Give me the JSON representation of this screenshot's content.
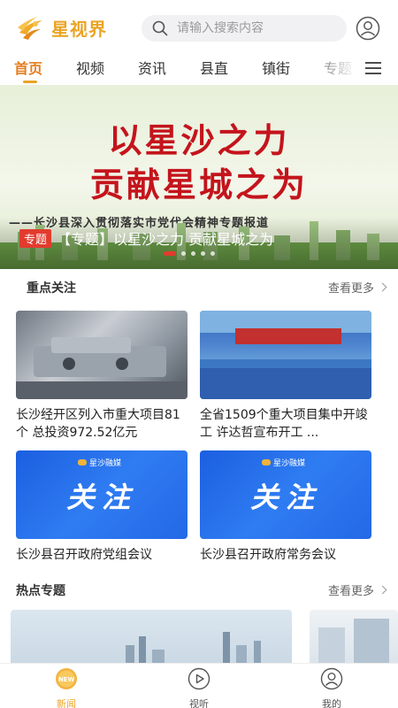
{
  "header": {
    "app_name": "星视界",
    "search_placeholder": "请输入搜索内容"
  },
  "nav": {
    "tabs": [
      "首页",
      "视频",
      "资讯",
      "县直",
      "镇街",
      "专题"
    ],
    "active": "首页"
  },
  "banner": {
    "title_line1": "以星沙之力",
    "title_line2": "贡献星城之为",
    "subtitle": "——长沙县深入贯彻落实市党代会精神专题报道",
    "badge": "专题",
    "caption": "【专题】以星沙之力 贡献星城之为",
    "slide_count": 5,
    "active_slide": 1
  },
  "focus": {
    "title": "重点关注",
    "more": "查看更多",
    "cards": [
      {
        "title": "长沙经开区列入市重大项目81个 总投资972.52亿元"
      },
      {
        "title": "全省1509个重大项目集中开竣工 许达哲宣布开工 ..."
      },
      {
        "title": "长沙县召开政府党组会议",
        "image_heading": "关注",
        "image_brand": "星沙融媒"
      },
      {
        "title": "长沙县召开政府常务会议",
        "image_heading": "关注",
        "image_brand": "星沙融媒"
      }
    ]
  },
  "hot": {
    "title": "热点专题",
    "more": "查看更多"
  },
  "bottom_nav": {
    "items": [
      {
        "label": "新闻",
        "badge": "NEW",
        "icon": "news-icon"
      },
      {
        "label": "视听",
        "icon": "play-icon"
      },
      {
        "label": "我的",
        "icon": "user-icon"
      }
    ],
    "active": "新闻"
  },
  "colors": {
    "brand": "#e9a425",
    "active_tab": "#e47d1f",
    "banner_red": "#c4141c",
    "badge_red": "#e23b2e"
  }
}
